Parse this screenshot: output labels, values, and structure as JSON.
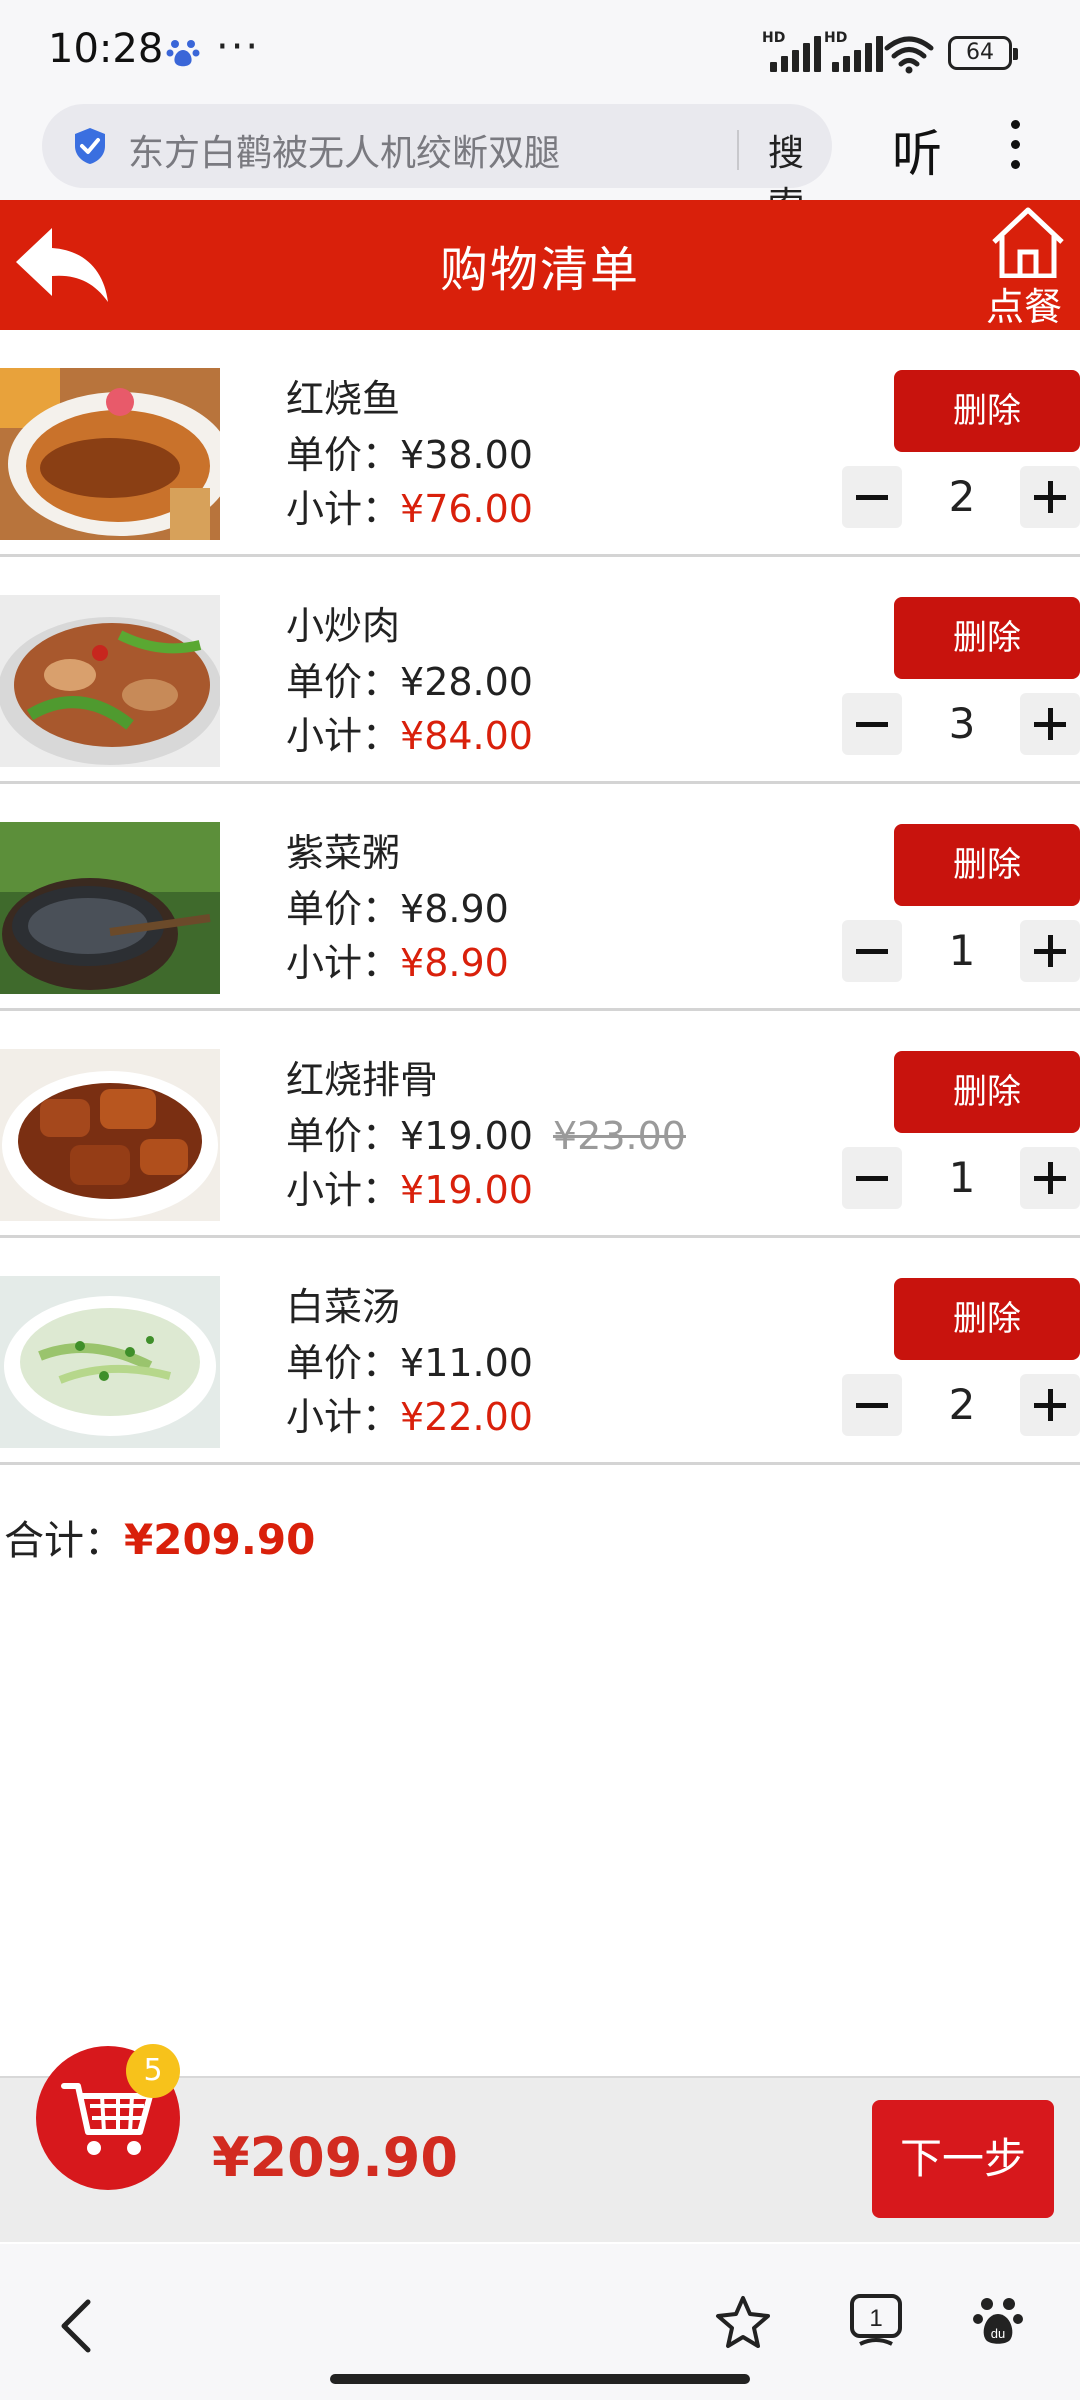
{
  "status_bar": {
    "time": "10:28",
    "dots": "···",
    "hd_label": "HD",
    "battery": "64",
    "icons": [
      "baidu-paw-icon",
      "signal-icon",
      "signal-icon",
      "wifi-icon",
      "battery-icon"
    ]
  },
  "browser": {
    "search_placeholder": "东方白鹳被无人机绞断双腿",
    "search_button": "搜索",
    "listen_button": "听",
    "icons": [
      "shield-icon",
      "more-icon"
    ]
  },
  "header": {
    "title": "购物清单",
    "home_label": "点餐",
    "background": "#d9200b",
    "icons": [
      "back-arrow-icon",
      "home-icon"
    ]
  },
  "labels": {
    "unit_price_prefix": "单价：",
    "subtotal_prefix": "小计：",
    "delete": "删除",
    "total_prefix": "合计："
  },
  "items": [
    {
      "name": "红烧鱼",
      "price": "¥38.00",
      "old_price": "",
      "subtotal": "¥76.00",
      "qty": "2"
    },
    {
      "name": "小炒肉",
      "price": "¥28.00",
      "old_price": "",
      "subtotal": "¥84.00",
      "qty": "3"
    },
    {
      "name": "紫菜粥",
      "price": "¥8.90",
      "old_price": "",
      "subtotal": "¥8.90",
      "qty": "1"
    },
    {
      "name": "红烧排骨",
      "price": "¥19.00",
      "old_price": "¥23.00",
      "subtotal": "¥19.00",
      "qty": "1"
    },
    {
      "name": "白菜汤",
      "price": "¥11.00",
      "old_price": "",
      "subtotal": "¥22.00",
      "qty": "2"
    }
  ],
  "total": "¥209.90",
  "cart": {
    "badge_count": "5",
    "total": "¥209.90",
    "next_button": "下一步",
    "accent": "#d7181c",
    "badge_color": "#f7c21b"
  },
  "bottom_nav": {
    "tab_count": "1",
    "icons": [
      "back-icon",
      "star-icon",
      "tabs-icon",
      "baidu-paw-icon"
    ]
  }
}
